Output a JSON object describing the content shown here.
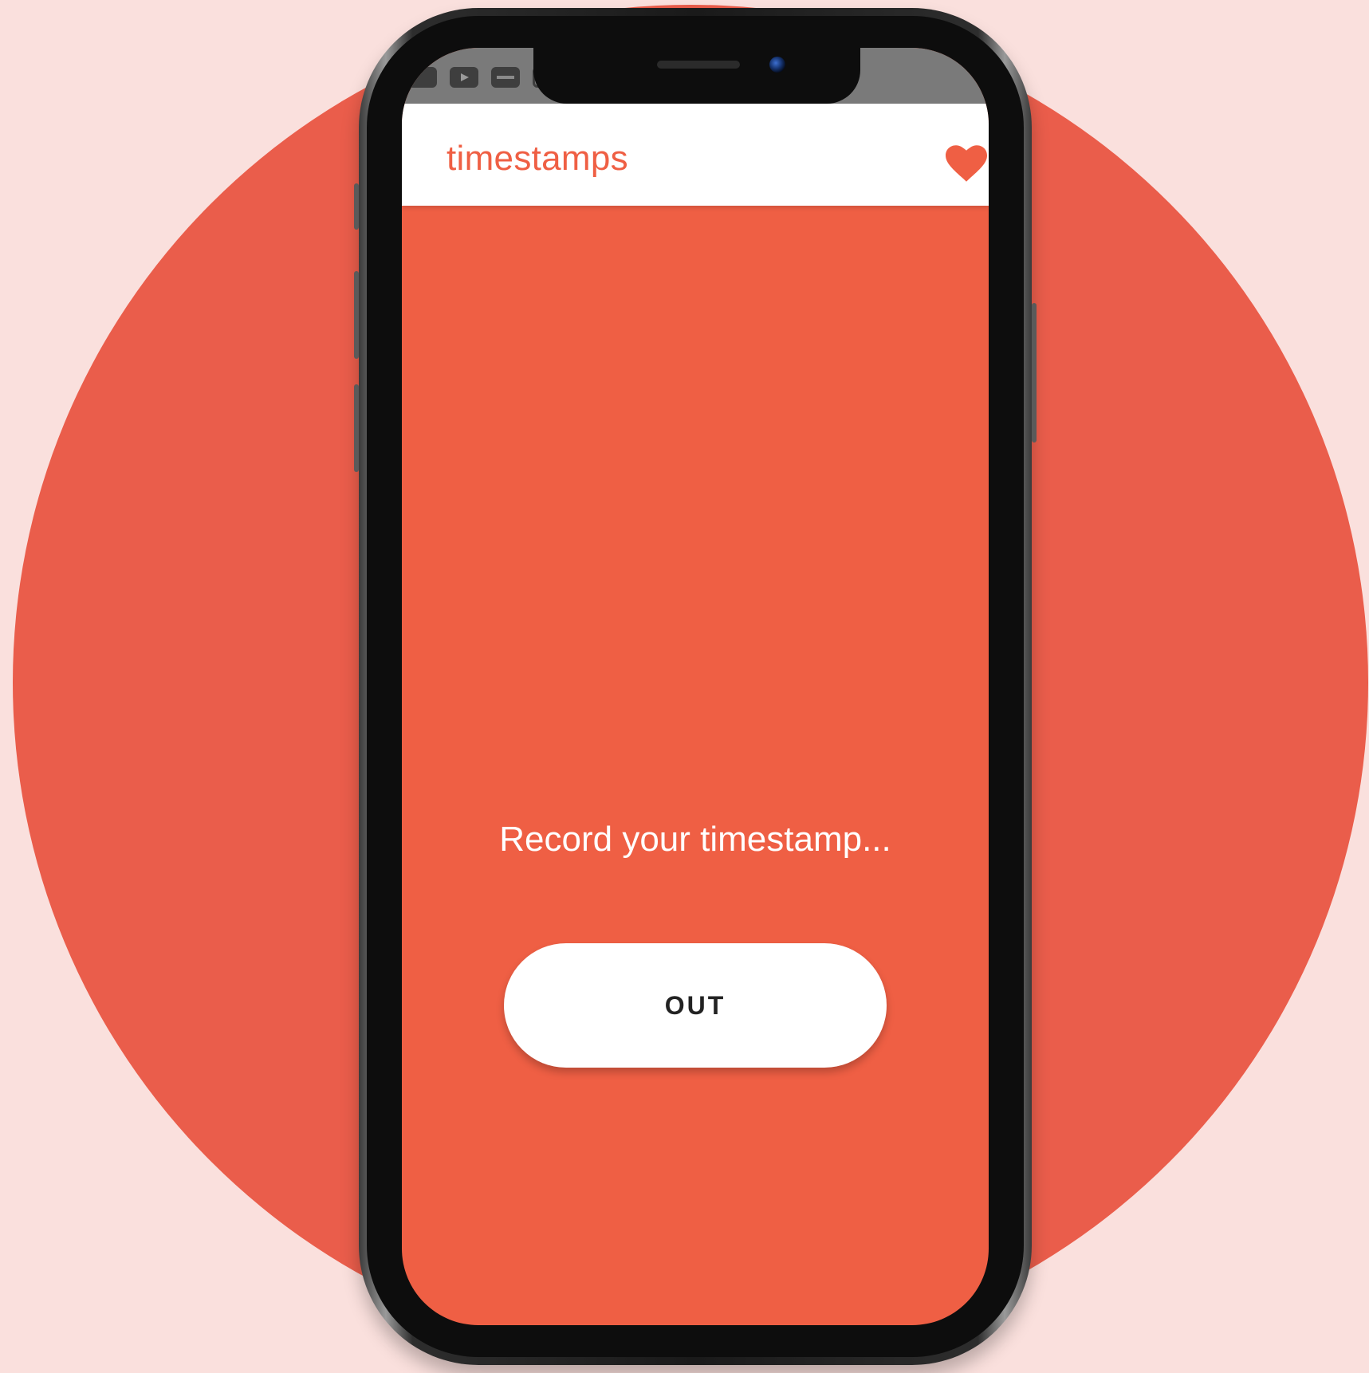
{
  "app": {
    "title": "timestamps",
    "favorite_icon": "heart-icon",
    "accent_color": "#ef5f44"
  },
  "status_bar": {
    "icons": [
      "video-icon",
      "play-icon",
      "keyboard-icon",
      "clipboard-icon"
    ]
  },
  "main": {
    "prompt": "Record your timestamp...",
    "action_button_label": "OUT"
  },
  "colors": {
    "background": "#fae0dd",
    "circle": "#ea5d4b",
    "screen": "#ef5f44",
    "button": "#ffffff"
  }
}
